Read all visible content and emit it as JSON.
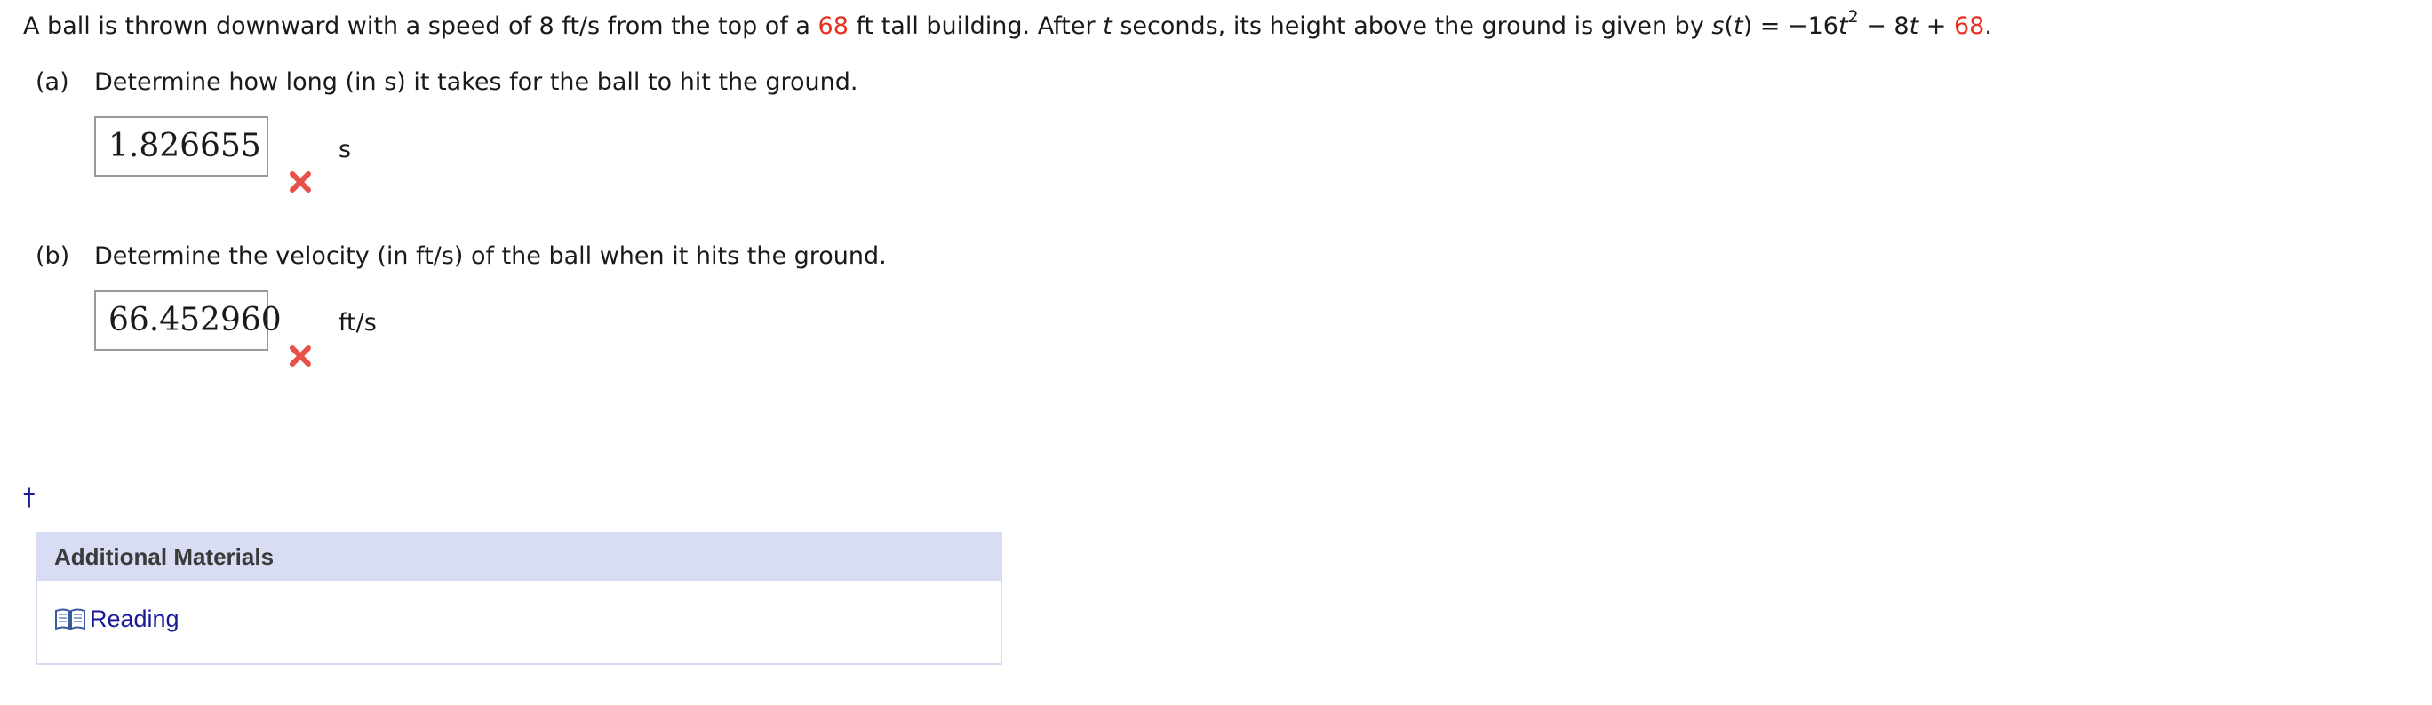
{
  "problem": {
    "text_1": "A ball is thrown downward with a speed of 8 ft/s from the top of a ",
    "height_value": "68",
    "text_2": " ft tall building. After ",
    "t_var": "t",
    "text_3": " seconds, its height above the ground is given by ",
    "s_func": "s",
    "s_arg_open": "(",
    "s_arg": "t",
    "s_arg_close": ")",
    "equals": " = −16",
    "t_sq": "t",
    "exp": "2",
    "minus_8": " − 8",
    "t_lin": "t",
    "plus": " + ",
    "const_value": "68",
    "period": "."
  },
  "part_a": {
    "letter": "(a)",
    "question": "Determine how long (in s) it takes for the ball to hit the ground.",
    "answer_value": "1.826655",
    "unit": "s",
    "status": "incorrect"
  },
  "part_b": {
    "letter": "(b)",
    "question": "Determine the velocity (in ft/s) of the ball when it hits the ground.",
    "answer_value": "66.452960",
    "unit": "ft/s",
    "status": "incorrect"
  },
  "dagger": "†",
  "additional_materials": {
    "header": "Additional Materials",
    "link_label": "Reading",
    "link_icon": "book-icon"
  },
  "colors": {
    "highlight_red": "#e8301f",
    "incorrect_mark": "#e8514a",
    "link_blue": "#1a1a99",
    "panel_header_bg": "#d8ddf4"
  }
}
